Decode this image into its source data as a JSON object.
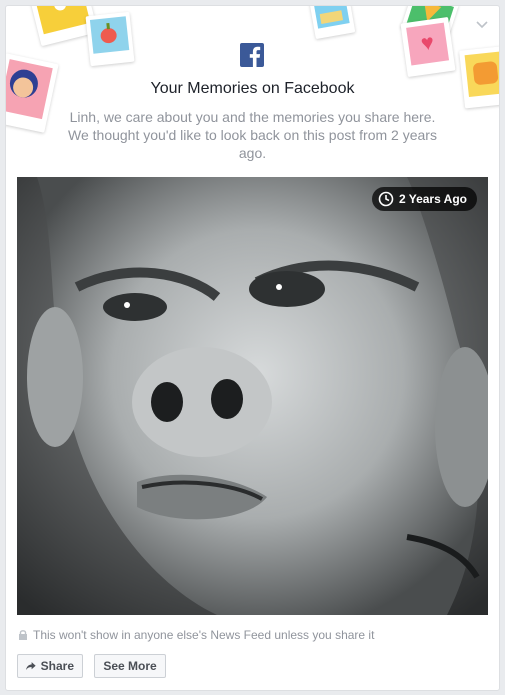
{
  "header": {
    "title": "Your Memories on Facebook",
    "message": "Linh, we care about you and the memories you share here. We thought you'd like to look back on this post from 2 years ago."
  },
  "photo": {
    "badge_label": "2 Years Ago"
  },
  "footer": {
    "privacy_note": "This won't show in anyone else's News Feed unless you share it",
    "share_label": "Share",
    "see_more_label": "See More"
  },
  "icons": {
    "brand": "facebook-logo-icon",
    "clock": "clock-icon",
    "lock": "lock-icon",
    "share": "share-arrow-icon",
    "options": "chevron-down-icon"
  },
  "colors": {
    "brand": "#3b5998",
    "title": "#1d2129",
    "muted": "#90949c"
  }
}
